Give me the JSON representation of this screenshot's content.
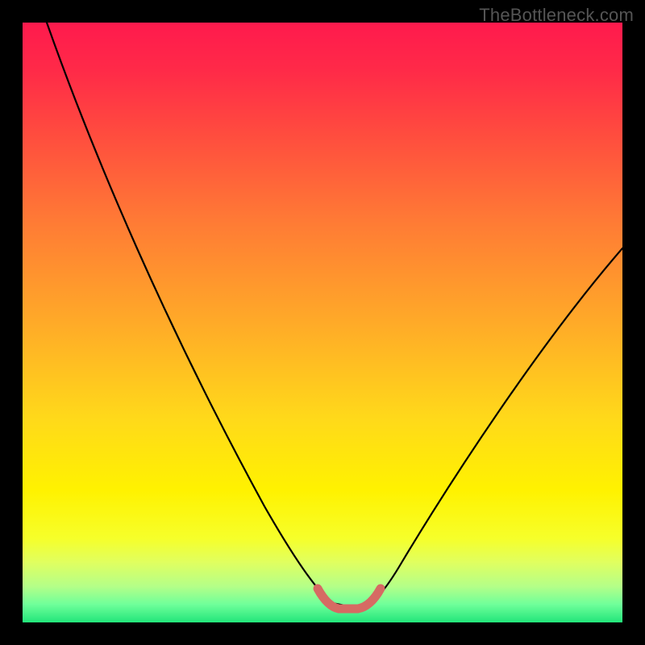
{
  "watermark": "TheBottleneck.com",
  "chart_data": {
    "type": "line",
    "title": "",
    "xlabel": "",
    "ylabel": "",
    "xlim": [
      0,
      100
    ],
    "ylim": [
      0,
      100
    ],
    "series": [
      {
        "name": "bottleneck-curve",
        "x": [
          4,
          10,
          20,
          30,
          40,
          48,
          51,
          55,
          58,
          60,
          65,
          72,
          80,
          90,
          100
        ],
        "y": [
          100,
          88,
          70,
          52,
          34,
          16,
          6,
          2,
          2,
          4,
          10,
          20,
          32,
          46,
          60
        ]
      },
      {
        "name": "good-range-marker",
        "x": [
          49,
          51,
          55,
          59,
          61
        ],
        "y": [
          5,
          2,
          1.5,
          2,
          5
        ]
      }
    ],
    "colors": {
      "curve": "#000000",
      "marker": "#d66a63",
      "gradient_top": "#ff1a4d",
      "gradient_bottom": "#22e57a"
    }
  }
}
